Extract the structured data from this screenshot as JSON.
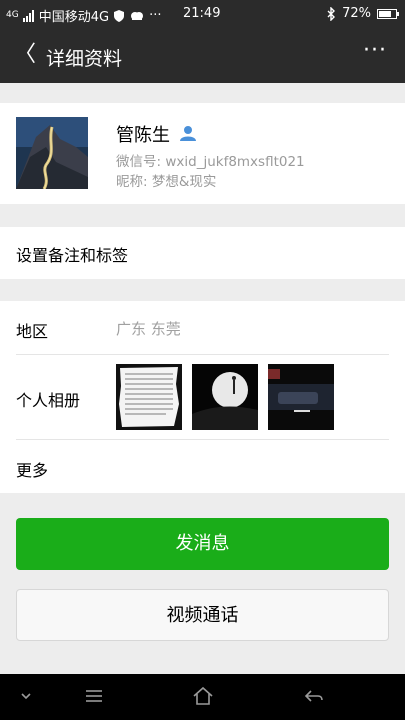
{
  "status_bar": {
    "signal_label": "4G",
    "carrier": "中国移动4G",
    "dots": "···",
    "time": "21:49",
    "battery": "72%",
    "battery_level": 0.72
  },
  "header": {
    "back_glyph": "〈",
    "title": "详细资料",
    "more_glyph": "···"
  },
  "profile": {
    "name": "管陈生",
    "wechat_id": "微信号: wxid_jukf8mxsflt021",
    "nickname": "昵称: 梦想&现实"
  },
  "remark_row": {
    "label": "设置备注和标签"
  },
  "region_row": {
    "label": "地区",
    "value": "广东  东莞"
  },
  "album_row": {
    "label": "个人相册"
  },
  "more_row": {
    "label": "更多"
  },
  "actions": {
    "send_message": "发消息",
    "video_call": "视频通话"
  },
  "colors": {
    "header_bg": "#2b2b2b",
    "primary_green": "#1aad19",
    "verified_icon": "#4a90d9"
  },
  "icons": [
    "back-icon",
    "more-icon",
    "person-verified-icon",
    "nav-down-icon",
    "nav-menu-icon",
    "nav-home-icon",
    "nav-back-icon"
  ]
}
